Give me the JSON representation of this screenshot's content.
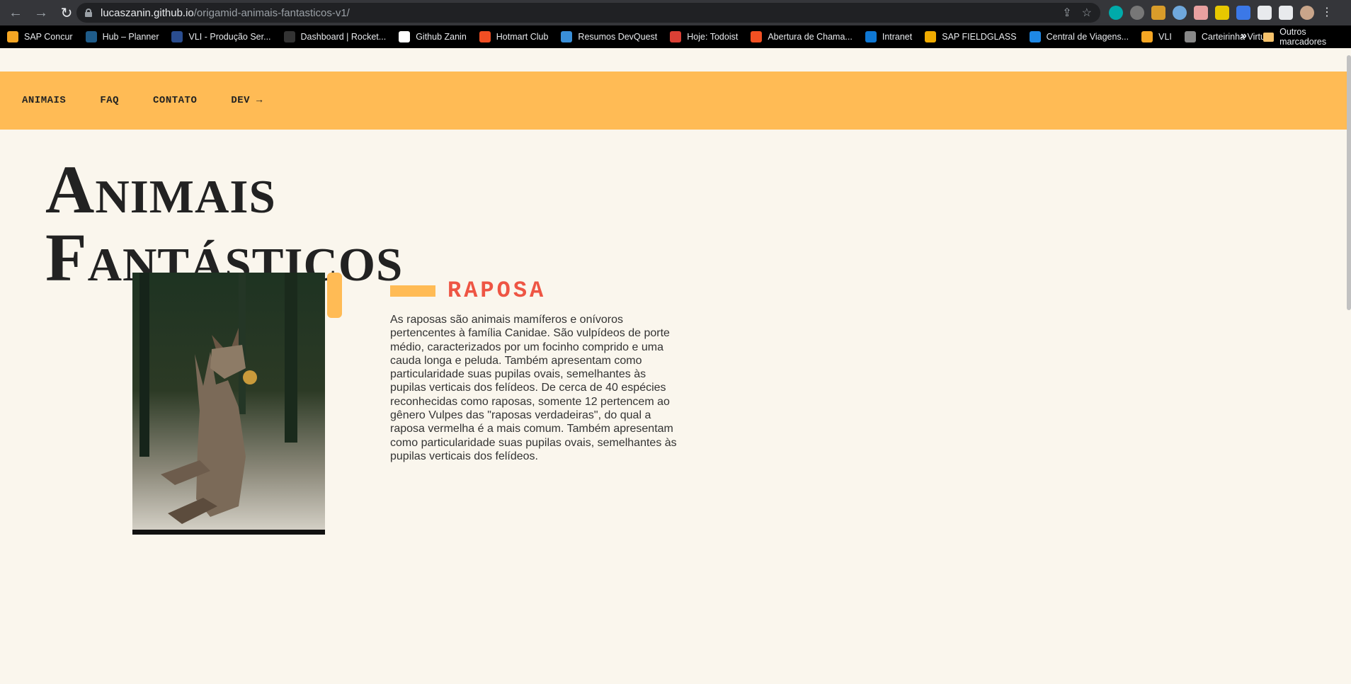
{
  "browser": {
    "url_host": "lucaszanin.github.io",
    "url_path": "/origamid-animais-fantasticos-v1/",
    "bookmarks": [
      {
        "label": "SAP Concur",
        "color": "#f5a623"
      },
      {
        "label": "Hub – Planner",
        "color": "#1f5c8a"
      },
      {
        "label": "VLI - Produção Ser...",
        "color": "#2a4d8f"
      },
      {
        "label": "Dashboard | Rocket...",
        "color": "#333333"
      },
      {
        "label": "Github Zanin",
        "color": "#ffffff"
      },
      {
        "label": "Hotmart Club",
        "color": "#f04e23"
      },
      {
        "label": "Resumos DevQuest",
        "color": "#3a8fd8"
      },
      {
        "label": "Hoje: Todoist",
        "color": "#db4035"
      },
      {
        "label": "Abertura de Chama...",
        "color": "#f25022"
      },
      {
        "label": "Intranet",
        "color": "#0f78d4"
      },
      {
        "label": "SAP FIELDGLASS",
        "color": "#f0ab00"
      },
      {
        "label": "Central de Viagens...",
        "color": "#1e88e5"
      },
      {
        "label": "VLI",
        "color": "#f5a623"
      },
      {
        "label": "Carteirinha Virtual",
        "color": "#888888"
      }
    ],
    "more": "»",
    "other_bookmarks": "Outros marcadores"
  },
  "menu": {
    "items": [
      "ANIMAIS",
      "FAQ",
      "CONTATO",
      "DEV →"
    ]
  },
  "page": {
    "title_line1": "Animais",
    "title_line2": "Fantásticos"
  },
  "animal": {
    "name": "RAPOSA",
    "description": "As raposas são animais mamíferos e onívoros pertencentes à família Canidae. São vulpídeos de porte médio, caracterizados por um focinho comprido e uma cauda longa e peluda. Também apresentam como particularidade suas pupilas ovais, semelhantes às pupilas verticais dos felídeos. De cerca de 40 espécies reconhecidas como raposas, somente 12 pertencem ao gênero Vulpes das \"raposas verdadeiras\", do qual a raposa vermelha é a mais comum. Também apresentam como particularidade suas pupilas ovais, semelhantes às pupilas verticais dos felídeos."
  },
  "colors": {
    "accent": "#ffbb55",
    "title_red": "#ee5544",
    "background": "#faf6ed"
  }
}
